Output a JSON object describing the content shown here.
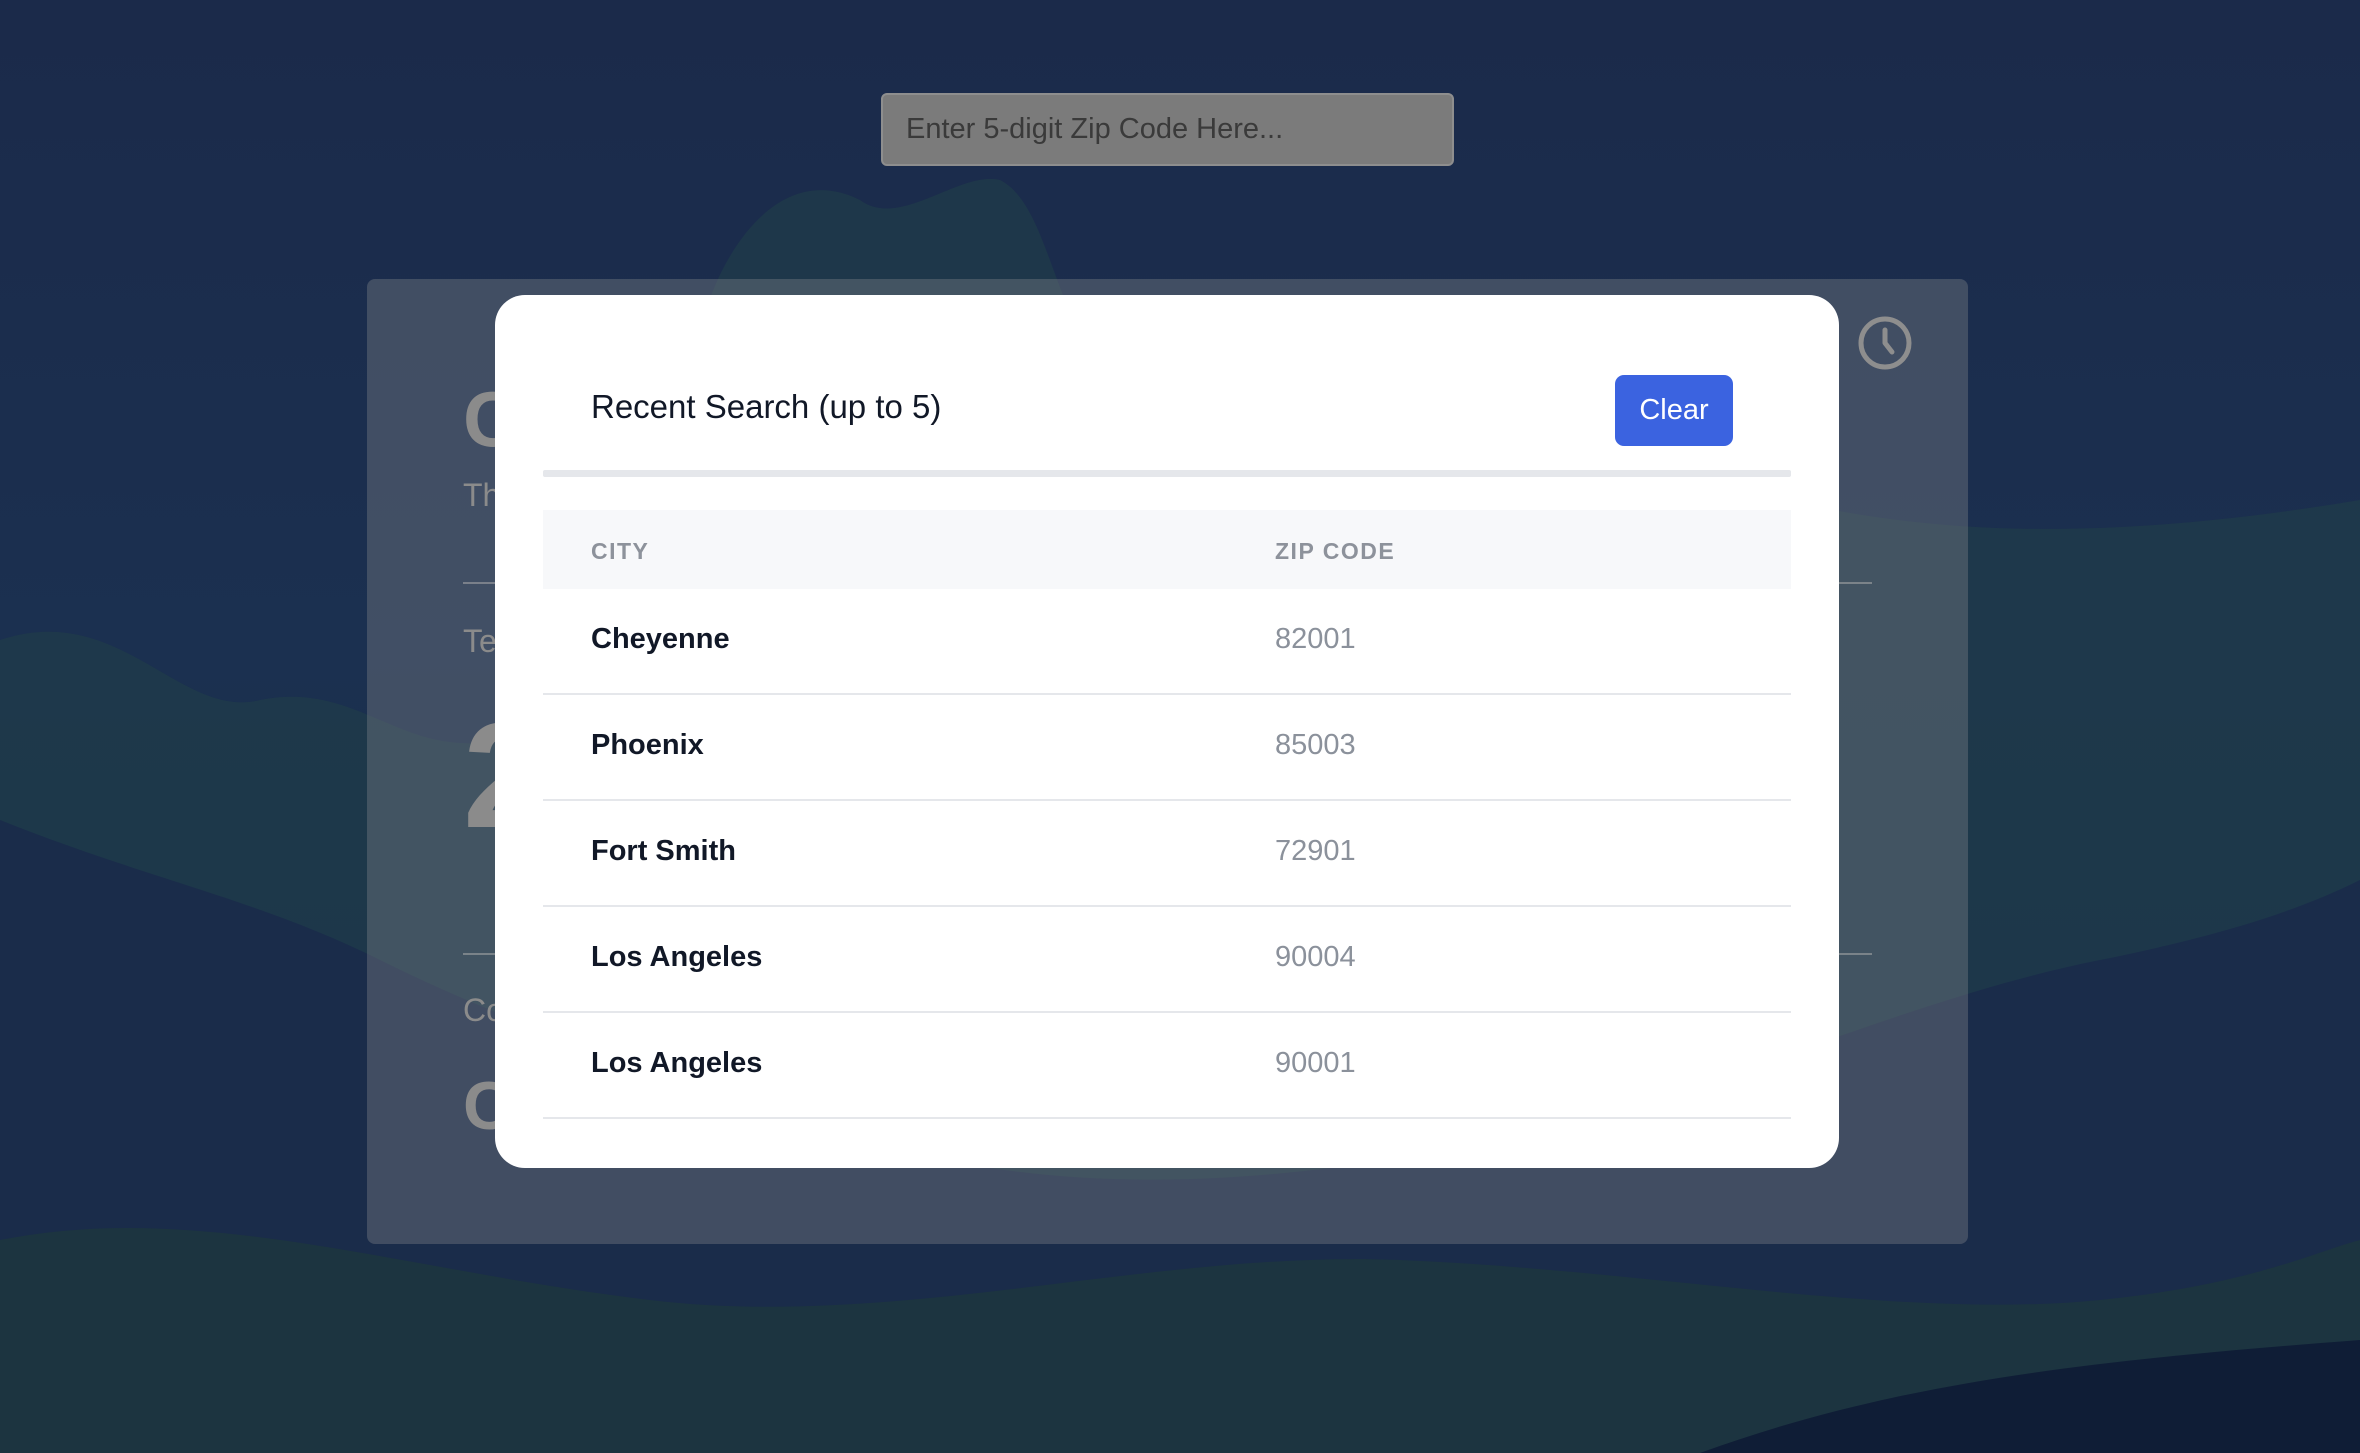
{
  "search": {
    "placeholder": "Enter 5-digit Zip Code Here..."
  },
  "background_card": {
    "city_fragment": "C",
    "subtitle_fragment": "Th",
    "temp_label_fragment": "Te",
    "temp_fragment": "2",
    "condition_label_fragment": "Co",
    "condition_fragment": "C"
  },
  "icons": {
    "history": "clock-icon"
  },
  "modal": {
    "title": "Recent Search (up to 5)",
    "clear_label": "Clear",
    "columns": [
      "CITY",
      "ZIP CODE"
    ],
    "rows": [
      {
        "city": "Cheyenne",
        "zip": "82001"
      },
      {
        "city": "Phoenix",
        "zip": "85003"
      },
      {
        "city": "Fort Smith",
        "zip": "72901"
      },
      {
        "city": "Los Angeles",
        "zip": "90004"
      },
      {
        "city": "Los Angeles",
        "zip": "90001"
      }
    ]
  },
  "colors": {
    "accent": "#3b63e0",
    "background": "#1b2a4a",
    "modal_bg": "#ffffff"
  }
}
